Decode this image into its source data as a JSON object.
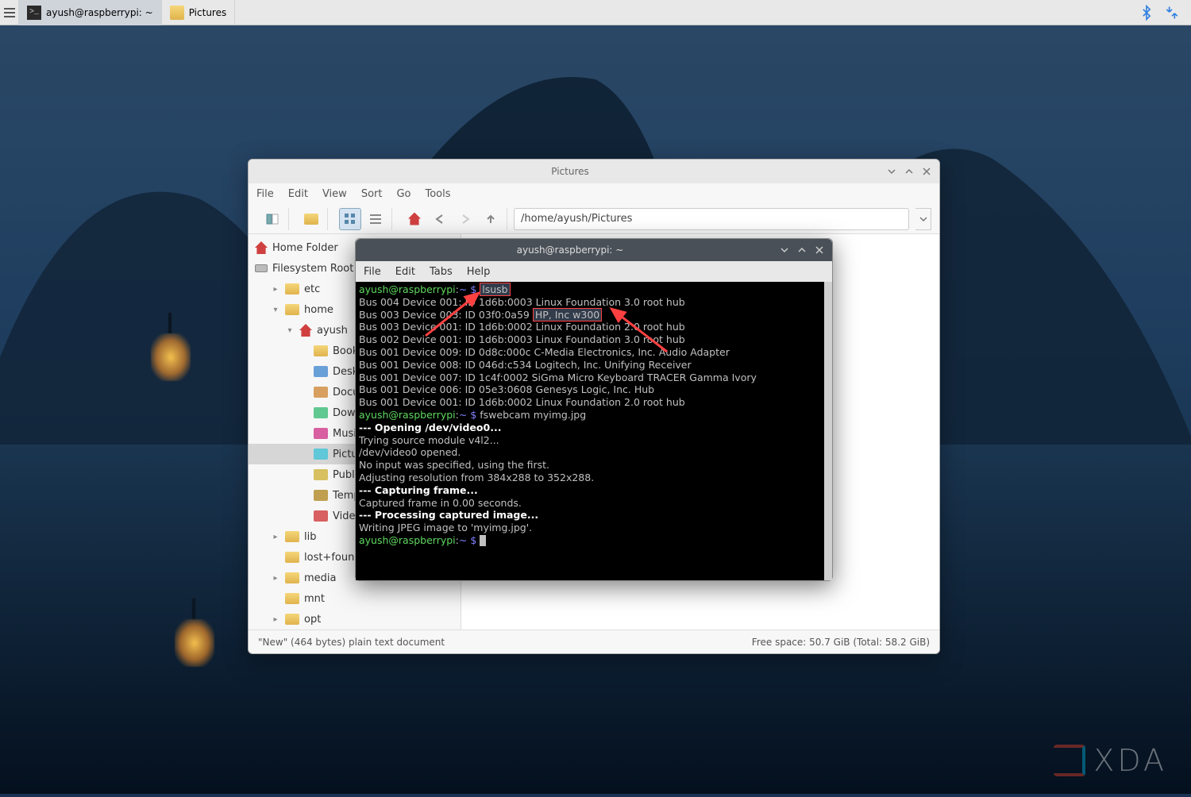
{
  "taskbar": {
    "terminal_label": "ayush@raspberrypi: ~",
    "pictures_label": "Pictures"
  },
  "watermark": {
    "text": "XDA"
  },
  "file_manager": {
    "title": "Pictures",
    "menu": [
      "File",
      "Edit",
      "View",
      "Sort",
      "Go",
      "Tools"
    ],
    "path": "/home/ayush/Pictures",
    "sidebar_top": [
      {
        "label": "Home Folder",
        "icon": "home"
      },
      {
        "label": "Filesystem Root",
        "icon": "drive"
      }
    ],
    "tree": [
      {
        "label": "etc",
        "level": 1,
        "expand": "▸"
      },
      {
        "label": "home",
        "level": 1,
        "expand": "▾"
      },
      {
        "label": "ayush",
        "level": 2,
        "expand": "▾",
        "home": true
      },
      {
        "label": "Bookshelf",
        "level": 3
      },
      {
        "label": "Desktop",
        "level": 3,
        "icon": "desktop"
      },
      {
        "label": "Documents",
        "level": 3,
        "icon": "docs"
      },
      {
        "label": "Downloads",
        "level": 3,
        "icon": "down"
      },
      {
        "label": "Music",
        "level": 3,
        "icon": "music"
      },
      {
        "label": "Pictures",
        "level": 3,
        "icon": "pics",
        "selected": true
      },
      {
        "label": "Public",
        "level": 3,
        "icon": "public"
      },
      {
        "label": "Templates",
        "level": 3,
        "icon": "tmpl"
      },
      {
        "label": "Videos",
        "level": 3,
        "icon": "vid"
      },
      {
        "label": "lib",
        "level": 1,
        "expand": "▸"
      },
      {
        "label": "lost+found",
        "level": 1
      },
      {
        "label": "media",
        "level": 1,
        "expand": "▸"
      },
      {
        "label": "mnt",
        "level": 1
      },
      {
        "label": "opt",
        "level": 1,
        "expand": "▸"
      }
    ],
    "status_left": "\"New\" (464 bytes) plain text document",
    "status_right": "Free space: 50.7 GiB (Total: 58.2 GiB)"
  },
  "terminal": {
    "title": "ayush@raspberrypi: ~",
    "menu": [
      "File",
      "Edit",
      "Tabs",
      "Help"
    ],
    "prompt_user": "ayush@raspberrypi",
    "prompt_path": "~",
    "cmd_lsusb": "lsusb",
    "usb_lines": [
      "Bus 004 Device 001: ID 1d6b:0003 Linux Foundation 3.0 root hub",
      "Bus 003 Device 003: ID 03f0:0a59 HP, Inc w300",
      "Bus 003 Device 001: ID 1d6b:0002 Linux Foundation 2.0 root hub",
      "Bus 002 Device 001: ID 1d6b:0003 Linux Foundation 3.0 root hub",
      "Bus 001 Device 009: ID 0d8c:000c C-Media Electronics, Inc. Audio Adapter",
      "Bus 001 Device 008: ID 046d:c534 Logitech, Inc. Unifying Receiver",
      "Bus 001 Device 007: ID 1c4f:0002 SiGma Micro Keyboard TRACER Gamma Ivory",
      "Bus 001 Device 006: ID 05e3:0608 Genesys Logic, Inc. Hub",
      "Bus 001 Device 001: ID 1d6b:0002 Linux Foundation 2.0 root hub"
    ],
    "highlight_device": "HP, Inc w300",
    "cmd_fswebcam": "fswebcam myimg.jpg",
    "output_lines": [
      {
        "t": "--- Opening /dev/video0...",
        "b": true
      },
      {
        "t": "Trying source module v4l2..."
      },
      {
        "t": "/dev/video0 opened."
      },
      {
        "t": "No input was specified, using the first."
      },
      {
        "t": "Adjusting resolution from 384x288 to 352x288."
      },
      {
        "t": "--- Capturing frame...",
        "b": true
      },
      {
        "t": "Captured frame in 0.00 seconds."
      },
      {
        "t": "--- Processing captured image...",
        "b": true
      },
      {
        "t": "Writing JPEG image to 'myimg.jpg'."
      }
    ]
  }
}
